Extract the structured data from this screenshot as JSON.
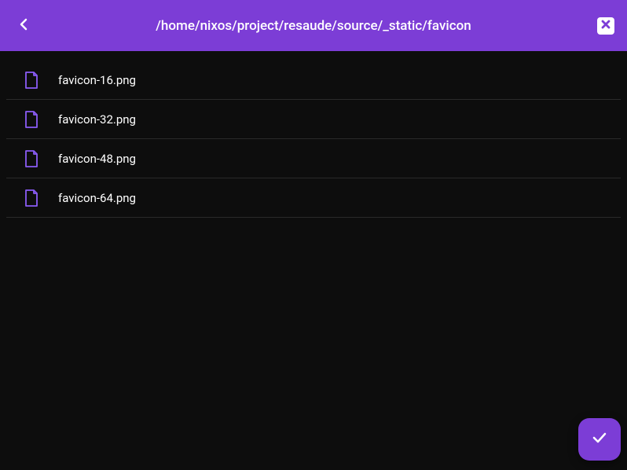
{
  "header": {
    "path": "/home/nixos/project/resaude/source/_static/favicon"
  },
  "files": [
    {
      "name": "favicon-16.png"
    },
    {
      "name": "favicon-32.png"
    },
    {
      "name": "favicon-48.png"
    },
    {
      "name": "favicon-64.png"
    }
  ],
  "colors": {
    "accent": "#7c3dd6",
    "icon_accent": "#8b5cf6",
    "background": "#0d0d0d"
  }
}
